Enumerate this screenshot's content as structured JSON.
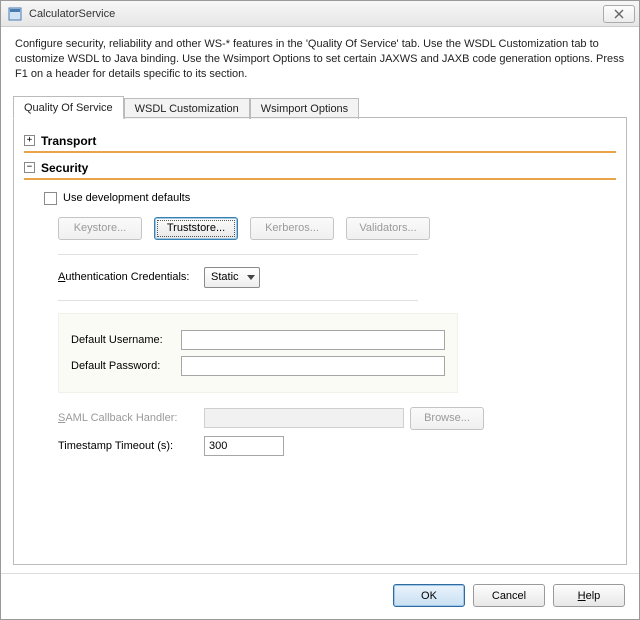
{
  "window": {
    "title": "CalculatorService"
  },
  "description": "Configure security, reliability and other WS-* features in the 'Quality Of Service' tab. Use the WSDL Customization tab to customize WSDL to Java binding. Use the Wsimport Options to set certain JAXWS and JAXB code generation options. Press F1 on a header for details specific to its section.",
  "tabs": {
    "qos": "Quality Of Service",
    "wsdl": "WSDL Customization",
    "wsimport": "Wsimport Options"
  },
  "sections": {
    "transport": {
      "title": "Transport",
      "expander": "+"
    },
    "security": {
      "title": "Security",
      "expander": "−"
    }
  },
  "security": {
    "use_defaults_label": "Use development defaults",
    "buttons": {
      "keystore": "Keystore...",
      "truststore": "Truststore...",
      "kerberos": "Kerberos...",
      "validators": "Validators..."
    },
    "auth_label": "Authentication Credentials:",
    "auth_value": "Static",
    "default_username_label": "Default Username:",
    "default_username_value": "",
    "default_password_label": "Default Password:",
    "default_password_value": "",
    "saml_label": "SAML Callback Handler:",
    "saml_value": "",
    "browse": "Browse...",
    "timeout_label": "Timestamp Timeout (s):",
    "timeout_value": "300"
  },
  "footer": {
    "ok": "OK",
    "cancel": "Cancel",
    "help": "Help"
  }
}
